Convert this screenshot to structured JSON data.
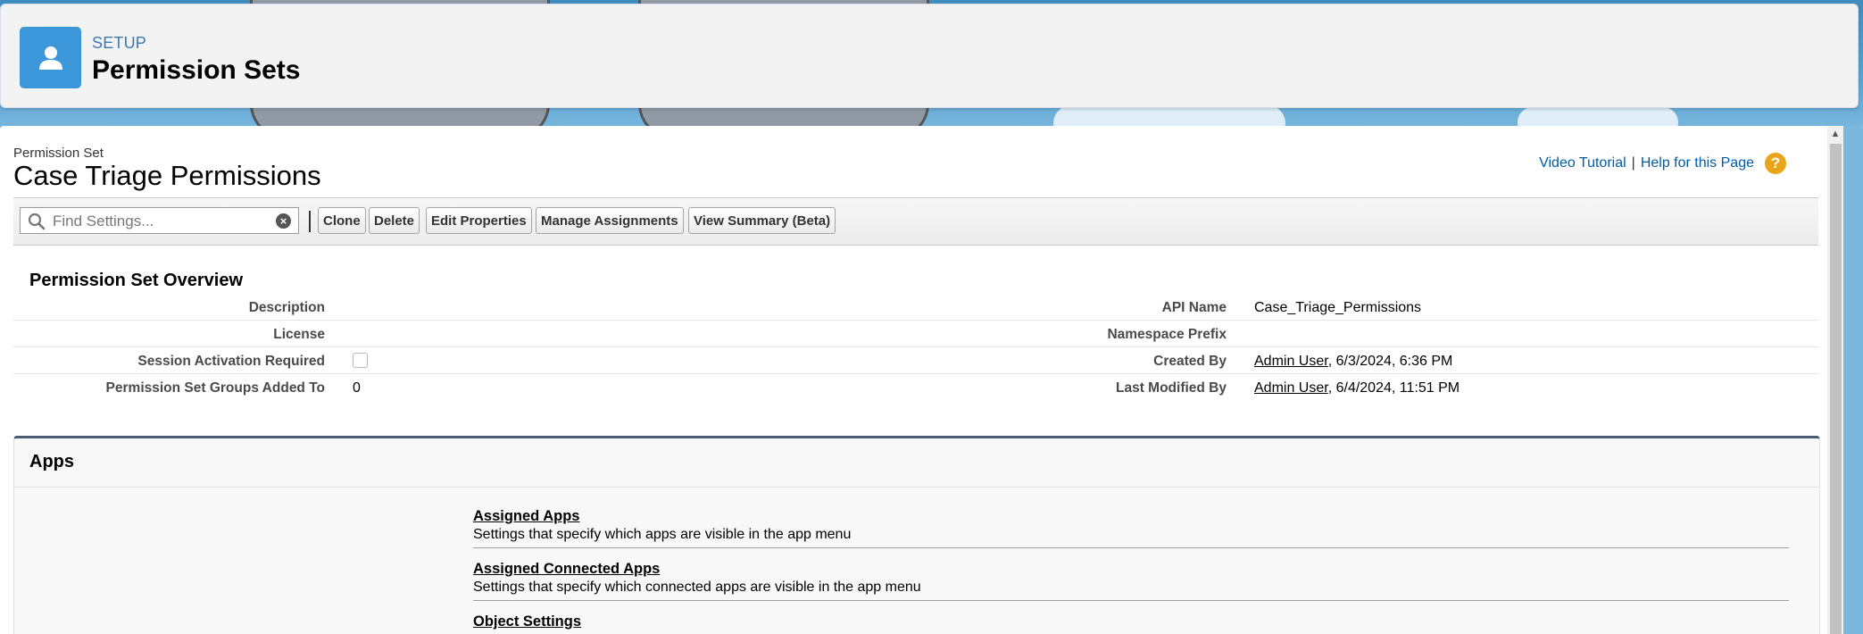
{
  "setup_header": {
    "eyebrow": "SETUP",
    "title": "Permission Sets"
  },
  "record": {
    "object_label": "Permission Set",
    "name": "Case Triage Permissions"
  },
  "help": {
    "video_tutorial": "Video Tutorial",
    "separator": "|",
    "help_page": "Help for this Page",
    "help_icon": "?"
  },
  "toolbar": {
    "search_placeholder": "Find Settings...",
    "clear_icon": "×",
    "buttons": {
      "clone": "Clone",
      "delete": "Delete",
      "edit_properties": "Edit Properties",
      "manage_assignments": "Manage Assignments",
      "view_summary": "View Summary (Beta)"
    }
  },
  "overview": {
    "title": "Permission Set Overview",
    "left": {
      "description_label": "Description",
      "description_value": "",
      "license_label": "License",
      "license_value": "",
      "session_label": "Session Activation Required",
      "session_checked": false,
      "groups_label": "Permission Set Groups Added To",
      "groups_value": "0"
    },
    "right": {
      "api_name_label": "API Name",
      "api_name_value": "Case_Triage_Permissions",
      "namespace_label": "Namespace Prefix",
      "namespace_value": "",
      "created_by_label": "Created By",
      "created_by_user": "Admin User",
      "created_by_date": ", 6/3/2024, 6:36 PM",
      "modified_by_label": "Last Modified By",
      "modified_by_user": "Admin User",
      "modified_by_date": ", 6/4/2024, 11:51 PM"
    }
  },
  "apps": {
    "title": "Apps",
    "items": [
      {
        "link": "Assigned Apps",
        "desc": "Settings that specify which apps are visible in the app menu"
      },
      {
        "link": "Assigned Connected Apps",
        "desc": "Settings that specify which connected apps are visible in the app menu"
      },
      {
        "link": "Object Settings",
        "desc": ""
      }
    ]
  },
  "icons": {
    "setup": "user-icon",
    "search": "search-icon",
    "clear": "clear-icon",
    "help": "help-icon",
    "scroll_up": "scroll-up-arrow-icon"
  },
  "colors": {
    "setup_icon_bg": "#3b97d9",
    "link": "#015ba7",
    "help_icon": "#e9a419",
    "section_accent": "#4a5a70"
  }
}
